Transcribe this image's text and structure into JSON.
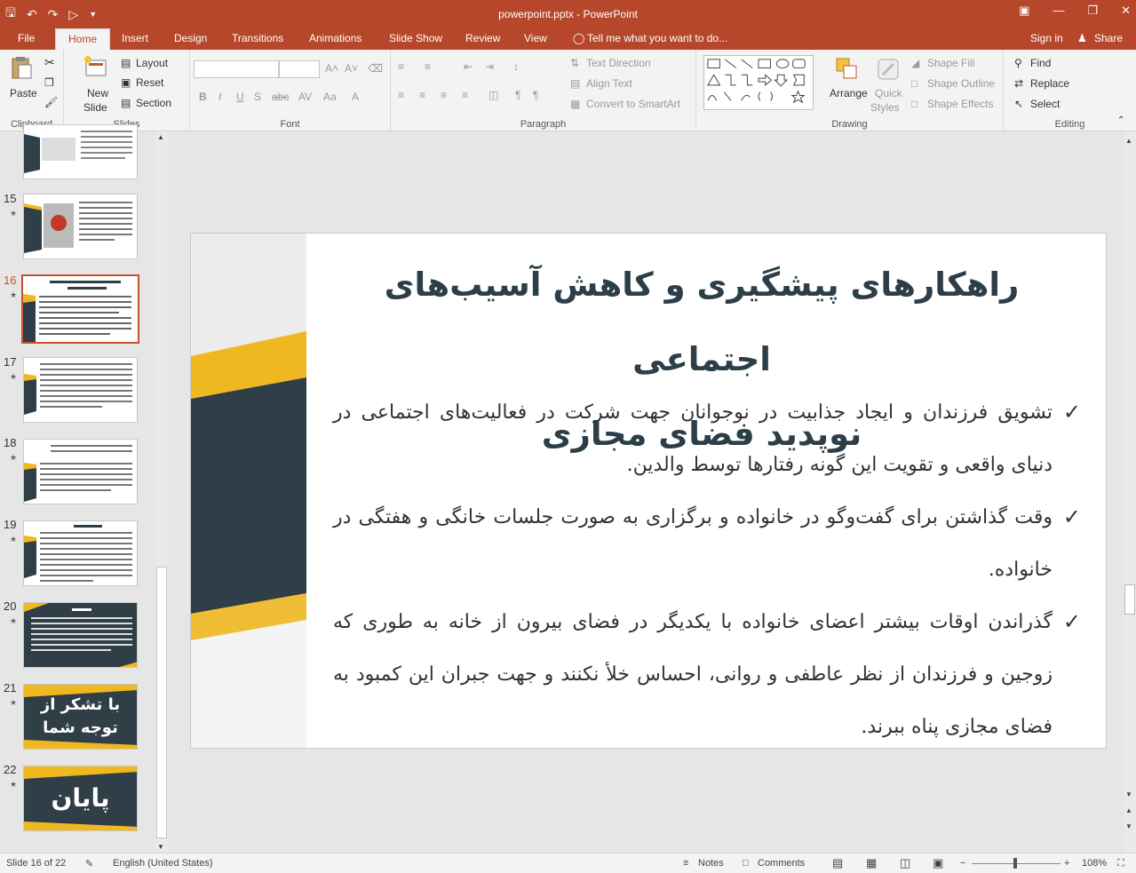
{
  "window": {
    "title": "powerpoint.pptx - PowerPoint"
  },
  "tabs": [
    "File",
    "Home",
    "Insert",
    "Design",
    "Transitions",
    "Animations",
    "Slide Show",
    "Review",
    "View"
  ],
  "tell_me": "Tell me what you want to do...",
  "account": {
    "sign_in": "Sign in",
    "share": "Share"
  },
  "ribbon": {
    "clipboard": {
      "label": "Clipboard",
      "paste": "Paste"
    },
    "slides": {
      "label": "Slides",
      "new_slide_1": "New",
      "new_slide_2": "Slide",
      "layout": "Layout",
      "reset": "Reset",
      "section": "Section"
    },
    "font": {
      "label": "Font"
    },
    "paragraph": {
      "label": "Paragraph",
      "text_direction": "Text Direction",
      "align_text": "Align Text",
      "convert_smartart": "Convert to SmartArt"
    },
    "drawing": {
      "label": "Drawing",
      "arrange": "Arrange",
      "quick_styles_1": "Quick",
      "quick_styles_2": "Styles",
      "shape_fill": "Shape Fill",
      "shape_outline": "Shape Outline",
      "shape_effects": "Shape Effects"
    },
    "editing": {
      "label": "Editing",
      "find": "Find",
      "replace": "Replace",
      "select": "Select"
    }
  },
  "thumbnails": [
    {
      "num": "15"
    },
    {
      "num": "16"
    },
    {
      "num": "17"
    },
    {
      "num": "18"
    },
    {
      "num": "19"
    },
    {
      "num": "20"
    },
    {
      "num": "21",
      "text_1": "با تشکر از",
      "text_2": "توجه شما"
    },
    {
      "num": "22",
      "text_1": "پایان"
    }
  ],
  "slide": {
    "title_line_1": "راهکارهای پیشگیری و کاهش آسیب‌های اجتماعی",
    "title_line_2": "نوپدید فضای مجازی",
    "bullets": [
      "تشویق فرزندان و ایجاد جذابیت در نوجوانان جهت شرکت در فعالیت‌های اجتماعی در دنیای واقعی و تقویت این گونه رفتارها توسط والدین.",
      "وقت گذاشتن برای گفت‌وگو در خانواده و برگزاری به صورت جلسات خانگی و هفتگی در خانواده.",
      "گذراندن اوقات بیشتر اعضای خانواده با یکدیگر در فضای بیرون از خانه به طوری که زوجین و فرزندان از نظر عاطفی و روانی، احساس خلأ نکنند و جهت جبران این کمبود به فضای مجازی پناه ببرند."
    ]
  },
  "status": {
    "slide_info": "Slide 16 of 22",
    "language": "English (United States)",
    "notes": "Notes",
    "comments": "Comments",
    "zoom": "108%"
  },
  "colors": {
    "accent": "#b7472a",
    "slide_dark": "#2f3e47",
    "slide_yellow": "#f0b820"
  }
}
